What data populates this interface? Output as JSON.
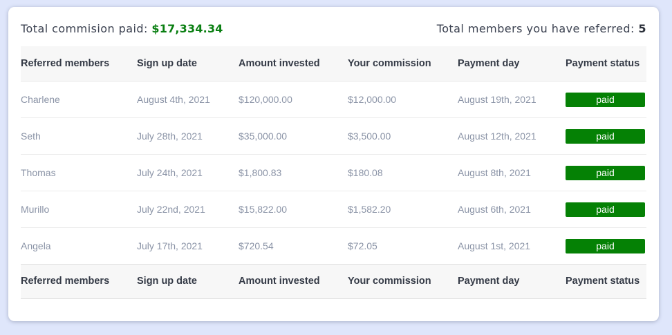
{
  "summary": {
    "commission_label": "Total commision paid:",
    "commission_amount": "$17,334.34",
    "referred_label": "Total members you have referred:",
    "referred_count": "5"
  },
  "table": {
    "columns": [
      "Referred members",
      "Sign up date",
      "Amount invested",
      "Your commission",
      "Payment day",
      "Payment status"
    ],
    "rows": [
      [
        "Charlene",
        "August 4th, 2021",
        "$120,000.00",
        "$12,000.00",
        "August 19th, 2021",
        "paid"
      ],
      [
        "Seth",
        "July 28th, 2021",
        "$35,000.00",
        "$3,500.00",
        "August 12th, 2021",
        "paid"
      ],
      [
        "Thomas",
        "July 24th, 2021",
        "$1,800.83",
        "$180.08",
        "August 8th, 2021",
        "paid"
      ],
      [
        "Murillo",
        "July 22nd, 2021",
        "$15,822.00",
        "$1,582.20",
        "August 6th, 2021",
        "paid"
      ],
      [
        "Angela",
        "July 17th, 2021",
        "$720.54",
        "$72.05",
        "August 1st, 2021",
        "paid"
      ]
    ]
  },
  "colors": {
    "accent_green": "#0a7f12",
    "badge_green": "#058105",
    "page_background": "#dfe6fb"
  }
}
